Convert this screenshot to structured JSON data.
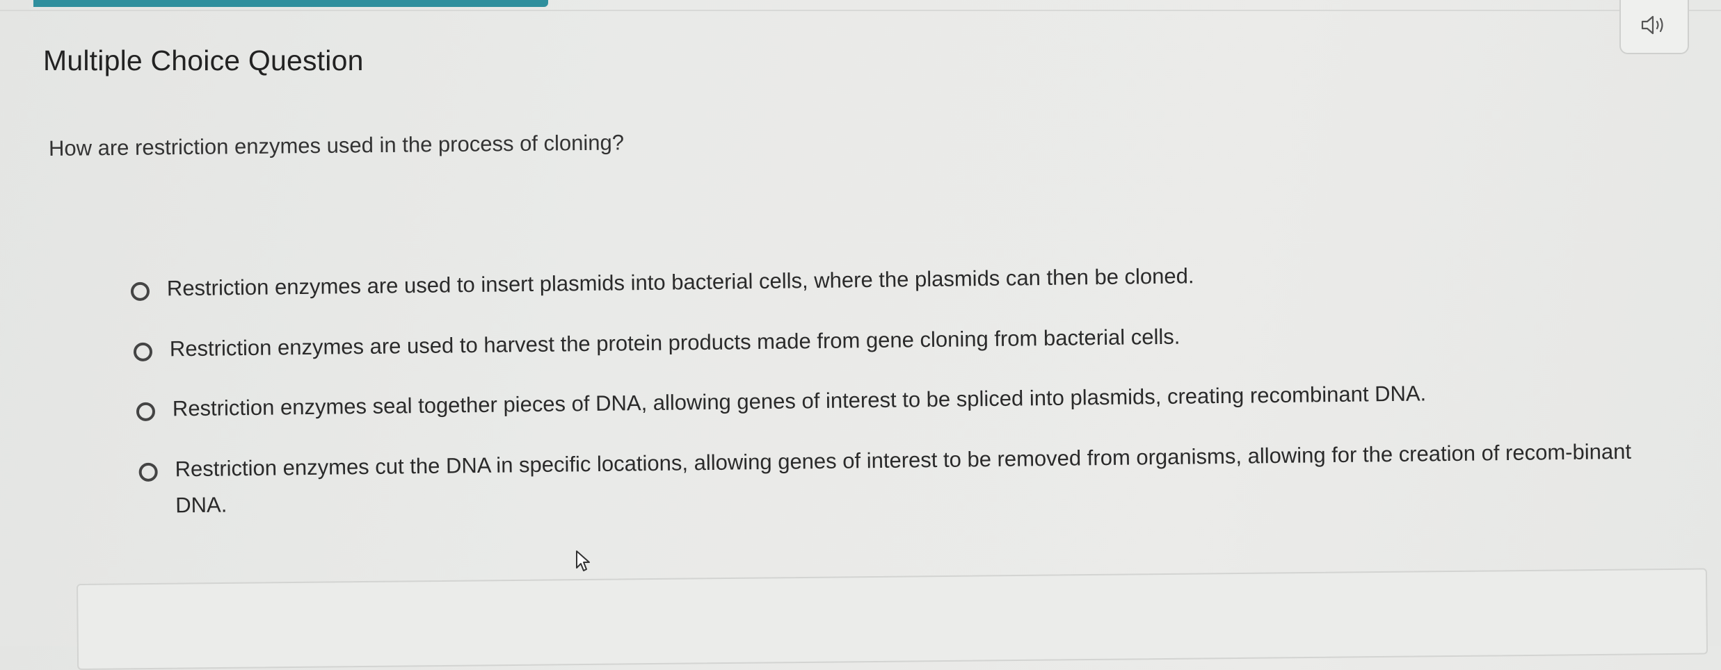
{
  "title": "Multiple Choice Question",
  "question": "How are restriction enzymes used in the process of cloning?",
  "audio_icon": "speaker-icon",
  "options": [
    {
      "label": "Restriction enzymes are used to insert plasmids into bacterial cells, where the plasmids can then be cloned."
    },
    {
      "label": "Restriction enzymes are used to harvest the protein products made from gene cloning from bacterial cells."
    },
    {
      "label": "Restriction enzymes seal together pieces of DNA, allowing genes of interest to be spliced into plasmids, creating recombinant DNA."
    },
    {
      "label": "Restriction enzymes cut the DNA in specific locations, allowing genes of interest to be removed from organisms, allowing for the creation of recom-binant DNA."
    }
  ],
  "accent_color": "#2f8f9d"
}
